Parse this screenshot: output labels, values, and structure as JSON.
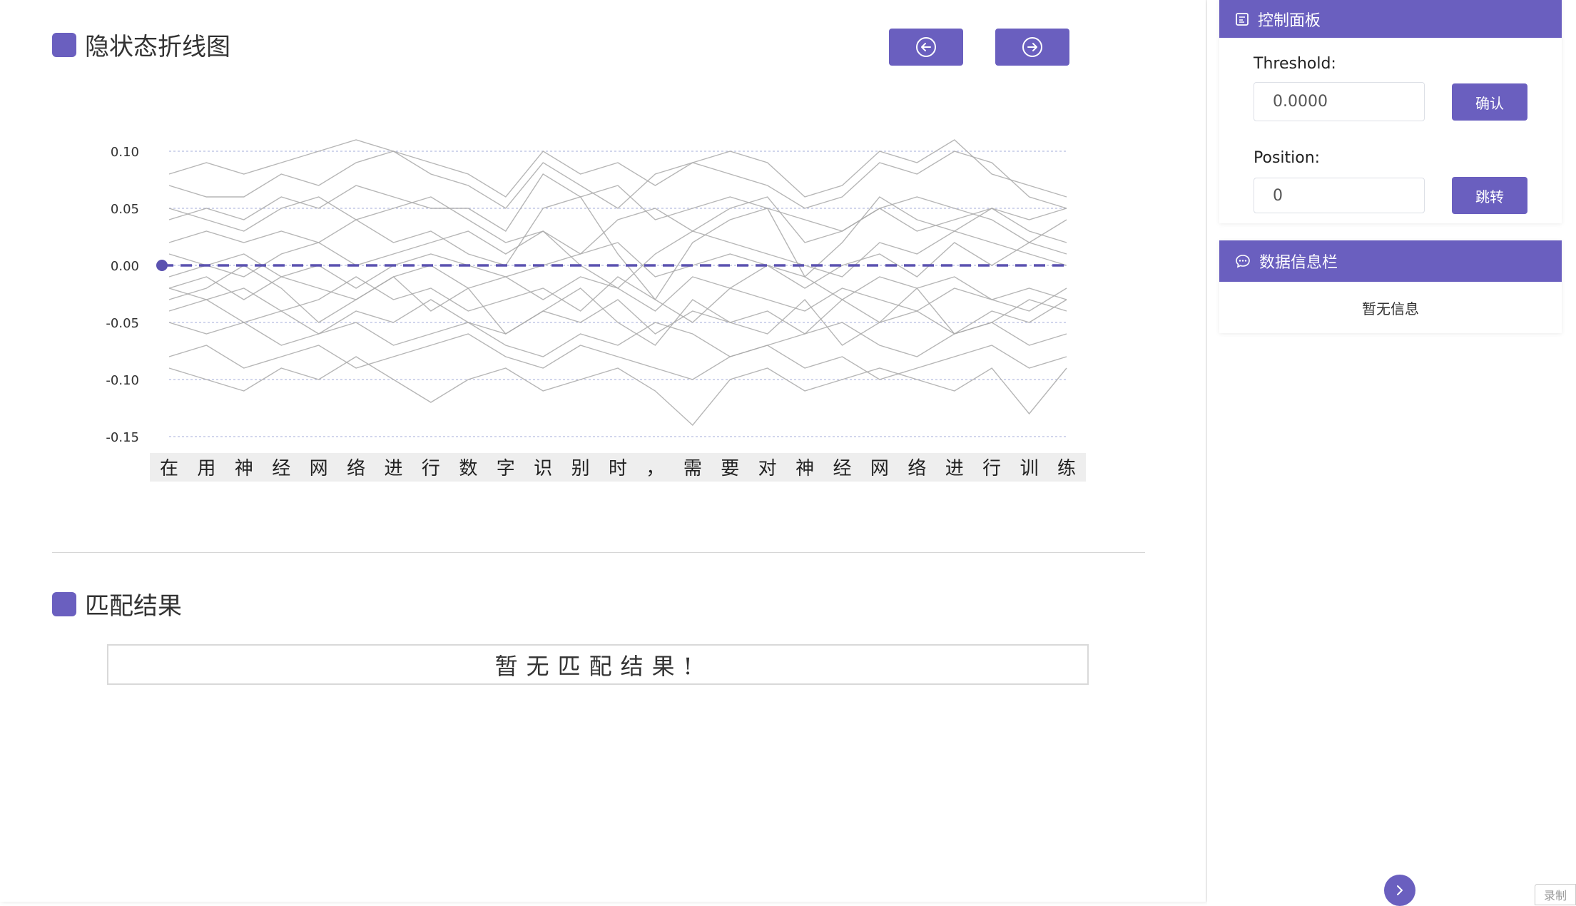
{
  "main": {
    "chart_section_title": "隐状态折线图",
    "match_section_title": "匹配结果",
    "no_match_text": "暂无匹配结果!",
    "prev_button_icon": "arrow-left-circle-icon",
    "next_button_icon": "arrow-right-circle-icon"
  },
  "side": {
    "control_panel": {
      "title": "控制面板",
      "icon": "panel-icon",
      "threshold_label": "Threshold:",
      "threshold_value": "0.0000",
      "confirm_label": "确认",
      "position_label": "Position:",
      "position_value": "0",
      "jump_label": "跳转"
    },
    "info_panel": {
      "title": "数据信息栏",
      "icon": "chat-icon",
      "empty_text": "暂无信息"
    }
  },
  "floating": {
    "expand_icon": "chevron-right-icon",
    "record_label": "录制"
  },
  "colors": {
    "accent": "#6A5FBF",
    "series": "#a9a9a9",
    "grid": "#b8bde0",
    "threshold_line": "#5b52b0"
  },
  "chart_data": {
    "type": "line",
    "title": "",
    "xlabel": "",
    "ylabel": "",
    "ylim": [
      -0.15,
      0.1
    ],
    "yticks": [
      "0.10",
      "0.05",
      "0.00",
      "-0.05",
      "-0.10",
      "-0.15"
    ],
    "ytick_values": [
      0.1,
      0.05,
      0.0,
      -0.05,
      -0.1,
      -0.15
    ],
    "categories": [
      "在",
      "用",
      "神",
      "经",
      "网",
      "络",
      "进",
      "行",
      "数",
      "字",
      "识",
      "别",
      "时",
      "，",
      "需",
      "要",
      "对",
      "神",
      "经",
      "网",
      "络",
      "进",
      "行",
      "训",
      "练"
    ],
    "threshold": 0.0,
    "grid": true,
    "series": [
      {
        "values": [
          0.08,
          0.09,
          0.08,
          0.09,
          0.1,
          0.11,
          0.1,
          0.09,
          0.08,
          0.06,
          0.1,
          0.08,
          0.09,
          0.07,
          0.09,
          0.1,
          0.09,
          0.06,
          0.07,
          0.1,
          0.09,
          0.11,
          0.08,
          0.07,
          0.06
        ]
      },
      {
        "values": [
          0.07,
          0.06,
          0.06,
          0.08,
          0.07,
          0.09,
          0.1,
          0.08,
          0.07,
          0.05,
          0.09,
          0.07,
          0.05,
          0.08,
          0.09,
          0.08,
          0.07,
          0.05,
          0.06,
          0.09,
          0.08,
          0.1,
          0.09,
          0.06,
          0.05
        ]
      },
      {
        "values": [
          0.04,
          0.05,
          0.04,
          0.06,
          0.05,
          0.07,
          0.06,
          0.05,
          0.05,
          0.03,
          0.08,
          0.06,
          0.07,
          0.04,
          0.05,
          0.06,
          0.05,
          0.04,
          0.03,
          0.05,
          0.06,
          0.05,
          0.04,
          0.02,
          0.04
        ]
      },
      {
        "values": [
          0.02,
          0.03,
          0.02,
          0.03,
          0.02,
          0.04,
          0.05,
          0.06,
          0.04,
          0.02,
          0.03,
          0.01,
          0.04,
          0.05,
          0.03,
          0.05,
          0.06,
          0.02,
          0.03,
          0.05,
          0.03,
          0.04,
          0.05,
          0.03,
          0.02
        ]
      },
      {
        "values": [
          0.01,
          0.0,
          -0.01,
          0.01,
          0.02,
          0.0,
          0.01,
          0.02,
          0.03,
          0.01,
          0.03,
          0.0,
          -0.02,
          0.01,
          0.03,
          0.02,
          0.01,
          0.0,
          -0.01,
          0.02,
          0.01,
          0.03,
          0.02,
          0.01,
          0.0
        ]
      },
      {
        "values": [
          -0.01,
          0.0,
          0.01,
          -0.01,
          0.0,
          -0.02,
          0.0,
          0.01,
          0.0,
          -0.01,
          0.0,
          0.01,
          0.02,
          -0.01,
          0.0,
          0.01,
          0.0,
          -0.02,
          0.0,
          0.01,
          -0.01,
          0.02,
          0.0,
          0.02,
          0.01
        ]
      },
      {
        "values": [
          -0.02,
          -0.01,
          -0.03,
          -0.01,
          -0.02,
          -0.03,
          -0.01,
          0.0,
          -0.02,
          -0.01,
          -0.03,
          -0.01,
          -0.02,
          -0.04,
          -0.01,
          -0.02,
          0.0,
          -0.01,
          -0.03,
          -0.01,
          -0.02,
          -0.01,
          -0.03,
          -0.04,
          -0.02
        ]
      },
      {
        "values": [
          -0.02,
          -0.03,
          -0.02,
          -0.04,
          -0.03,
          -0.01,
          -0.03,
          -0.02,
          -0.04,
          -0.03,
          -0.02,
          -0.04,
          -0.01,
          -0.03,
          -0.05,
          -0.02,
          -0.03,
          -0.04,
          -0.02,
          -0.03,
          -0.04,
          -0.02,
          -0.03,
          -0.02,
          -0.03
        ]
      },
      {
        "values": [
          -0.04,
          -0.03,
          -0.05,
          -0.04,
          -0.06,
          -0.04,
          -0.05,
          -0.03,
          -0.05,
          -0.06,
          -0.04,
          -0.05,
          -0.03,
          -0.06,
          -0.04,
          -0.05,
          -0.04,
          -0.06,
          -0.03,
          -0.05,
          -0.04,
          -0.06,
          -0.05,
          -0.03,
          -0.04
        ]
      },
      {
        "values": [
          -0.05,
          -0.06,
          -0.05,
          -0.07,
          -0.06,
          -0.05,
          -0.07,
          -0.06,
          -0.05,
          -0.07,
          -0.08,
          -0.06,
          -0.07,
          -0.05,
          -0.06,
          -0.08,
          -0.07,
          -0.06,
          -0.05,
          -0.07,
          -0.08,
          -0.06,
          -0.05,
          -0.07,
          -0.06
        ]
      },
      {
        "values": [
          -0.08,
          -0.07,
          -0.09,
          -0.08,
          -0.07,
          -0.09,
          -0.08,
          -0.07,
          -0.06,
          -0.08,
          -0.09,
          -0.07,
          -0.08,
          -0.09,
          -0.1,
          -0.08,
          -0.07,
          -0.09,
          -0.08,
          -0.1,
          -0.09,
          -0.08,
          -0.07,
          -0.09,
          -0.08
        ]
      },
      {
        "values": [
          -0.09,
          -0.1,
          -0.11,
          -0.09,
          -0.1,
          -0.08,
          -0.1,
          -0.12,
          -0.1,
          -0.09,
          -0.11,
          -0.1,
          -0.09,
          -0.11,
          -0.14,
          -0.1,
          -0.09,
          -0.11,
          -0.1,
          -0.09,
          -0.1,
          -0.11,
          -0.09,
          -0.13,
          -0.09
        ]
      },
      {
        "values": [
          0.05,
          0.04,
          0.03,
          0.05,
          0.06,
          0.04,
          0.02,
          0.03,
          0.01,
          0.0,
          0.05,
          0.06,
          0.01,
          -0.03,
          0.02,
          0.04,
          0.05,
          -0.01,
          0.02,
          0.06,
          0.04,
          0.03,
          0.05,
          0.04,
          0.05
        ]
      },
      {
        "values": [
          -0.03,
          -0.02,
          0.0,
          -0.02,
          -0.05,
          -0.03,
          -0.01,
          -0.04,
          -0.02,
          -0.06,
          -0.04,
          -0.02,
          -0.05,
          -0.07,
          -0.03,
          -0.05,
          -0.06,
          -0.03,
          -0.07,
          -0.05,
          -0.02,
          -0.06,
          -0.04,
          -0.05,
          -0.03
        ]
      }
    ]
  }
}
